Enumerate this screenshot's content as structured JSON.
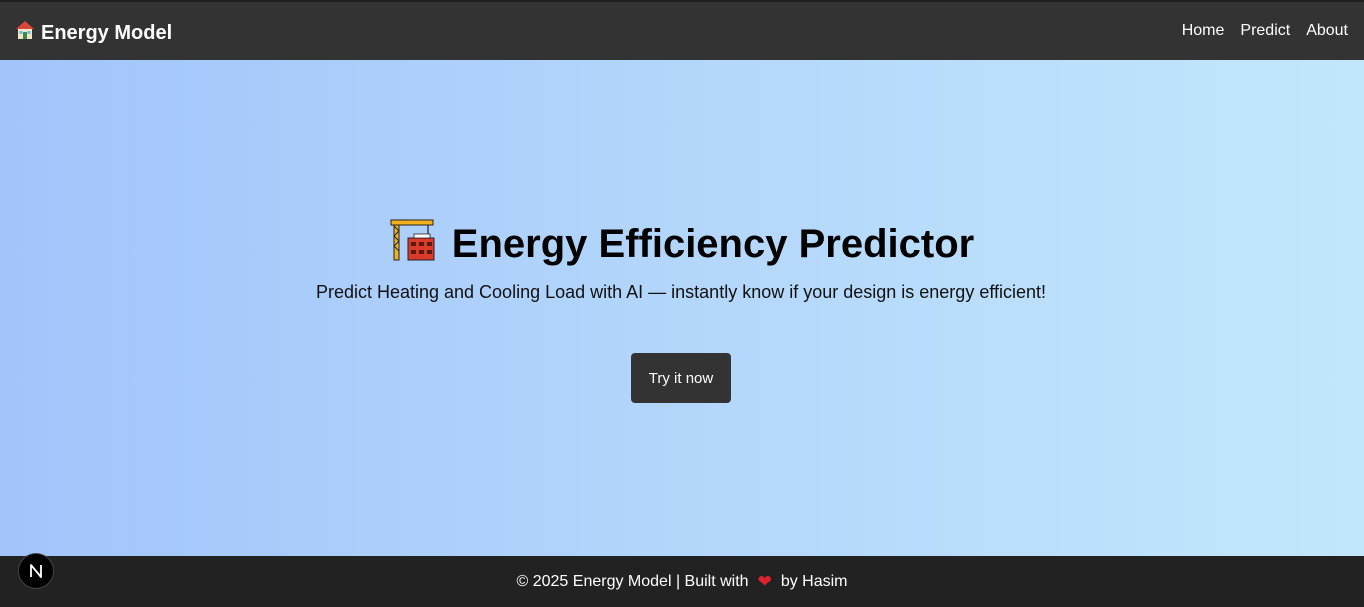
{
  "navbar": {
    "brand_label": "Energy Model",
    "brand_icon": "house-icon",
    "links": [
      {
        "label": "Home"
      },
      {
        "label": "Predict"
      },
      {
        "label": "About"
      }
    ]
  },
  "hero": {
    "title_icon": "construction-crane-icon",
    "title": "Energy Efficiency Predictor",
    "subtitle": "Predict Heating and Cooling Load with AI — instantly know if your design is energy efficient!",
    "cta_label": "Try it now"
  },
  "footer": {
    "prefix": "© 2025 Energy Model | Built with",
    "heart": "❤",
    "suffix": "by Hasim"
  },
  "colors": {
    "navbar_bg": "#333333",
    "footer_bg": "#222222",
    "hero_gradient_start": "#a2c4fb",
    "hero_gradient_end": "#c2e7fb",
    "cta_bg": "#333333",
    "heart": "#e0222e"
  }
}
